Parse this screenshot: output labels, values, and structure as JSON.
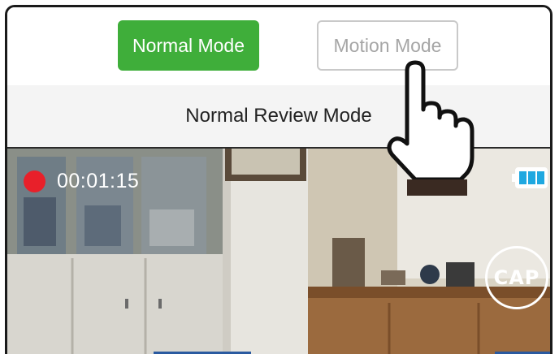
{
  "mode_selector": {
    "normal_label": "Normal Mode",
    "motion_label": "Motion Mode",
    "selected": "Normal Mode"
  },
  "review_bar": {
    "label": "Normal Review Mode"
  },
  "video": {
    "recording_time": "00:01:15",
    "capture_label": "CAP",
    "battery_level": 1.0
  },
  "icons": {
    "record": "record-dot-icon",
    "battery": "battery-icon",
    "pointer": "hand-pointer-icon"
  },
  "colors": {
    "active_green": "#3fae3a",
    "record_red": "#e8202a",
    "battery_cyan": "#1fa8e0",
    "inactive_text": "#a6a6a6"
  }
}
